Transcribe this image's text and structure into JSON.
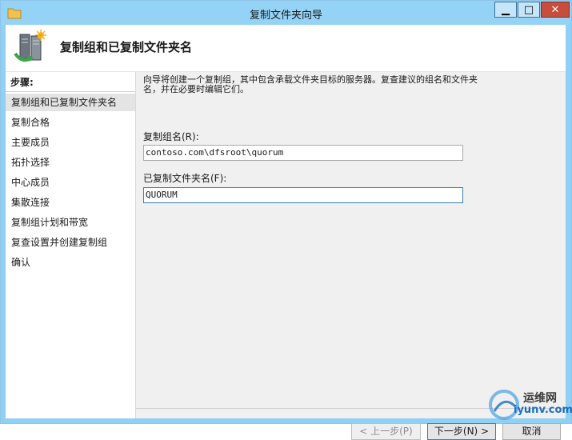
{
  "window": {
    "title": "复制文件夹向导",
    "min_glyph": "▁",
    "max_glyph": "□",
    "close_glyph": "✕"
  },
  "header": {
    "title": "复制组和已复制文件夹名"
  },
  "sidebar": {
    "heading": "步骤:",
    "items": [
      {
        "label": "复制组和已复制文件夹名",
        "active": true
      },
      {
        "label": "复制合格"
      },
      {
        "label": "主要成员"
      },
      {
        "label": "拓扑选择"
      },
      {
        "label": "中心成员"
      },
      {
        "label": "集散连接"
      },
      {
        "label": "复制组计划和带宽"
      },
      {
        "label": "复查设置并创建复制组"
      },
      {
        "label": "确认"
      }
    ]
  },
  "main": {
    "description": "向导将创建一个复制组，其中包含承载文件夹目标的服务器。复查建议的组名和文件夹名，并在必要时编辑它们。",
    "replication_group_label": "复制组名(R):",
    "replication_group_value": "contoso.com\\dfsroot\\quorum",
    "replicated_folder_label": "已复制文件夹名(F):",
    "replicated_folder_value": "QUORUM"
  },
  "footer": {
    "back_label": "< 上一步(P)",
    "next_label": "下一步(N) >",
    "cancel_label": "取消"
  },
  "watermark": {
    "text": "运维网",
    "url": "iyunv.com"
  },
  "colors": {
    "titlebar": "#94d3f5",
    "close_button": "#c74d3d",
    "accent": "#3c7fb1"
  }
}
